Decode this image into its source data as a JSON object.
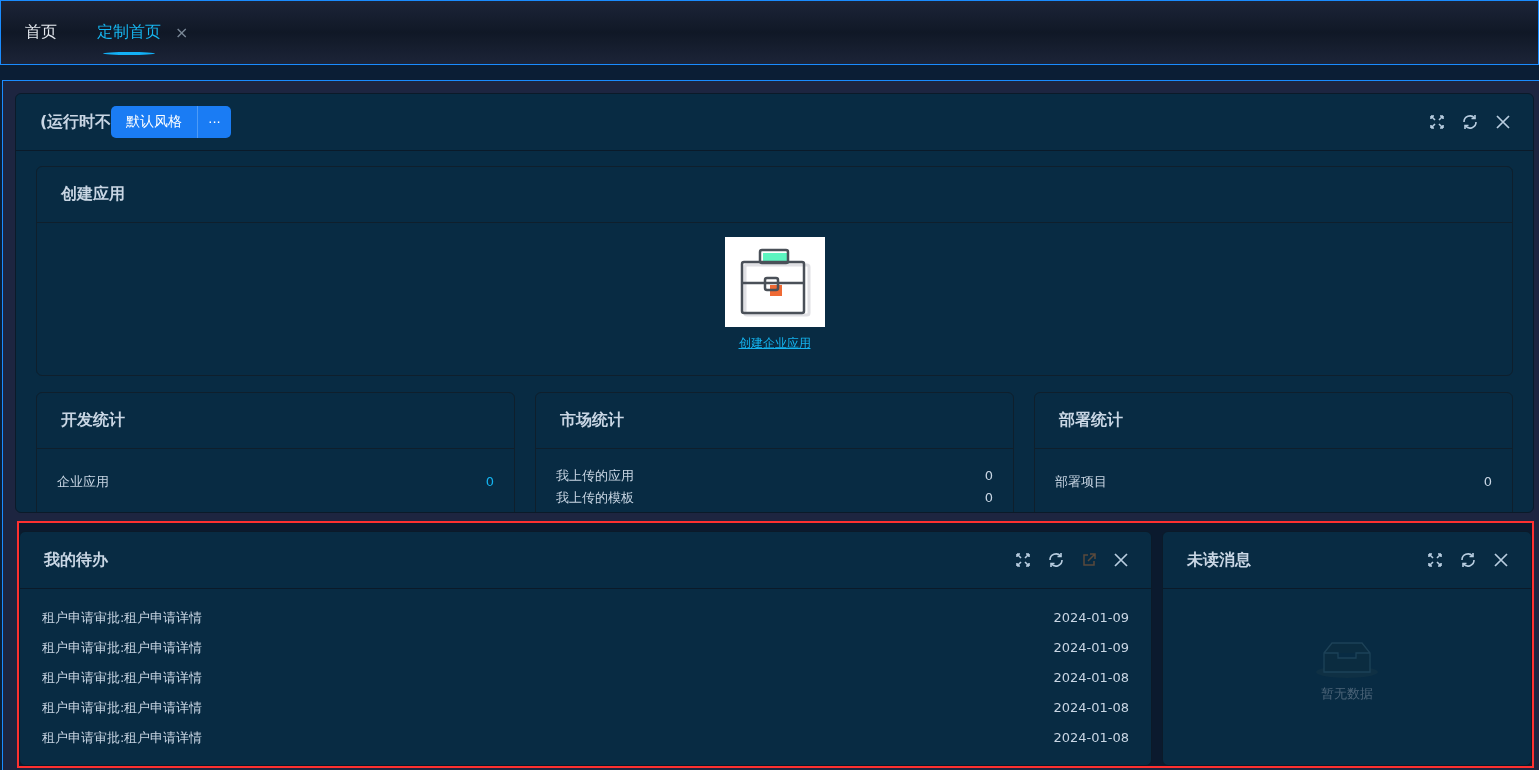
{
  "tabs": [
    {
      "label": "首页",
      "selected": false
    },
    {
      "label": "定制首页",
      "selected": true,
      "close_glyph": "×"
    }
  ],
  "workspace": {
    "title": "(运行时不",
    "style_button": "默认风格",
    "more_button": "···",
    "tools": [
      {
        "kind": "expand"
      },
      {
        "kind": "refresh"
      },
      {
        "kind": "close"
      }
    ]
  },
  "create_app": {
    "title": "创建应用",
    "link": "创建企业应用"
  },
  "stats": [
    {
      "title": "开发统计",
      "rows": [
        {
          "label": "企业应用",
          "value": "0",
          "highlight": true
        }
      ]
    },
    {
      "title": "市场统计",
      "rows": [
        {
          "label": "我上传的应用",
          "value": "0",
          "highlight": false
        },
        {
          "label": "我上传的模板",
          "value": "0",
          "highlight": false
        }
      ]
    },
    {
      "title": "部署统计",
      "rows": [
        {
          "label": "部署项目",
          "value": "0",
          "highlight": false
        }
      ]
    }
  ],
  "todo": {
    "title": "我的待办",
    "tools": [
      {
        "kind": "expand"
      },
      {
        "kind": "refresh"
      },
      {
        "kind": "open",
        "disabled": true
      },
      {
        "kind": "close"
      }
    ],
    "items": [
      {
        "title": "租户申请审批:租户申请详情",
        "date": "2024-01-09"
      },
      {
        "title": "租户申请审批:租户申请详情",
        "date": "2024-01-09"
      },
      {
        "title": "租户申请审批:租户申请详情",
        "date": "2024-01-08"
      },
      {
        "title": "租户申请审批:租户申请详情",
        "date": "2024-01-08"
      },
      {
        "title": "租户申请审批:租户申请详情",
        "date": "2024-01-08"
      }
    ]
  },
  "unread": {
    "title": "未读消息",
    "tools": [
      {
        "kind": "expand"
      },
      {
        "kind": "refresh"
      },
      {
        "kind": "close"
      }
    ],
    "empty_text": "暂无数据"
  }
}
